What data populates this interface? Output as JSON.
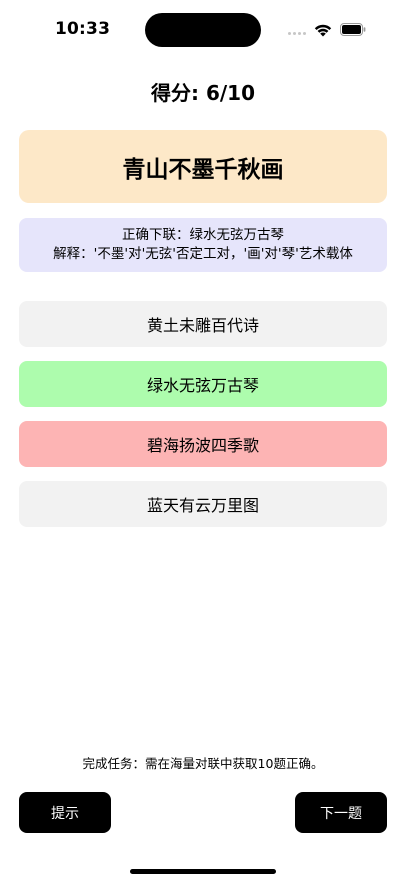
{
  "status_bar": {
    "time": "10:33"
  },
  "quiz": {
    "score_text": "得分: 6/10",
    "question": "青山不墨千秋画",
    "feedback": {
      "answer_line": "正确下联：绿水无弦万古琴",
      "explanation_line": "解释：'不墨'对'无弦'否定工对，'画'对'琴'艺术载体"
    },
    "options": [
      {
        "label": "黄土未雕百代诗",
        "state": "neutral"
      },
      {
        "label": "绿水无弦万古琴",
        "state": "correct"
      },
      {
        "label": "碧海扬波四季歌",
        "state": "wrong"
      },
      {
        "label": "蓝天有云万里图",
        "state": "neutral"
      }
    ],
    "task_text": "完成任务：需在海量对联中获取10题正确。",
    "hint_label": "提示",
    "next_label": "下一题"
  },
  "colors": {
    "question_bg": "#fde8c8",
    "feedback_bg": "#e6e5fb",
    "option_neutral": "#f2f2f2",
    "option_correct": "#adfcad",
    "option_wrong": "#fdb4b4",
    "button_bg": "#000000"
  }
}
